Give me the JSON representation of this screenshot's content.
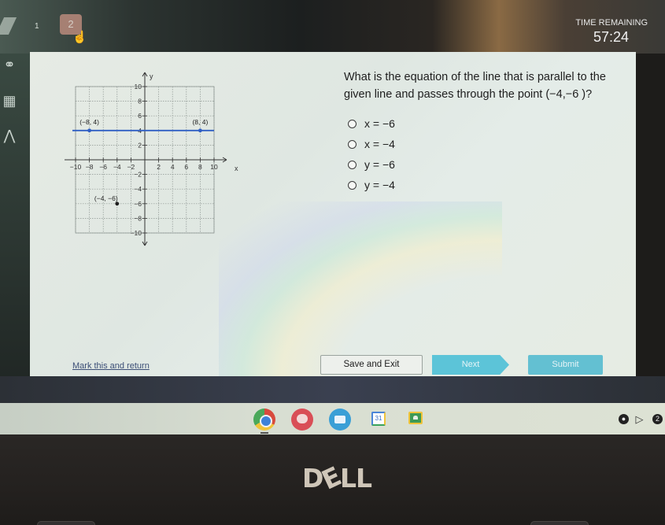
{
  "header": {
    "question_nav": {
      "previous_label": "1",
      "current_label": "2"
    },
    "timer": {
      "label": "TIME REMAINING",
      "value": "57:24"
    }
  },
  "left_rail": {
    "icons": [
      "headphones-icon",
      "calculator-icon",
      "pointer-icon"
    ]
  },
  "question": {
    "text": "What is the equation of the line that is parallel to the given line and passes through the point (−4,−6 )?",
    "options": [
      {
        "label": "x = −6"
      },
      {
        "label": "x = −4"
      },
      {
        "label": "y = −6"
      },
      {
        "label": "y = −4"
      }
    ]
  },
  "chart_data": {
    "type": "line",
    "title": "",
    "xlabel": "x",
    "ylabel": "y",
    "xlim": [
      -10,
      10
    ],
    "ylim": [
      -10,
      10
    ],
    "grid": true,
    "x_ticks": [
      -10,
      -8,
      -6,
      -4,
      -2,
      2,
      4,
      6,
      8,
      10
    ],
    "y_ticks": [
      10,
      8,
      6,
      4,
      2,
      -2,
      -4,
      -6,
      -8,
      -10
    ],
    "x_tick_labels": [
      "−10",
      "−8",
      "−6",
      "−4",
      "−2",
      "2",
      "4",
      "6",
      "8",
      "10"
    ],
    "y_tick_labels": [
      "10",
      "8",
      "6",
      "4",
      "2",
      "−2",
      "−4",
      "−6",
      "−8",
      "−10"
    ],
    "series": [
      {
        "name": "given line",
        "color": "#2f5fc4",
        "x": [
          -10,
          10
        ],
        "y": [
          4,
          4
        ]
      }
    ],
    "points": [
      {
        "x": -8,
        "y": 4,
        "label": "(−8, 4)",
        "color": "#2f5fc4"
      },
      {
        "x": 8,
        "y": 4,
        "label": "(8, 4)",
        "color": "#2f5fc4"
      },
      {
        "x": -4,
        "y": -6,
        "label": "(−4, −6)",
        "color": "#1e1e1e"
      }
    ]
  },
  "footer": {
    "mark_label": "Mark this and return",
    "save_label": "Save and Exit",
    "next_label": "Next",
    "submit_label": "Submit"
  },
  "shelf": {
    "apps": [
      "chrome-icon",
      "chat-icon",
      "cards-icon",
      "calendar-icon",
      "classroom-icon"
    ],
    "calendar_day": "31",
    "tray_badge": "2"
  },
  "bezel": {
    "brand": "DELL"
  },
  "colors": {
    "line": "#2f5fc4",
    "next_button": "#5cc4d8",
    "submit_button": "#63c0d2"
  }
}
